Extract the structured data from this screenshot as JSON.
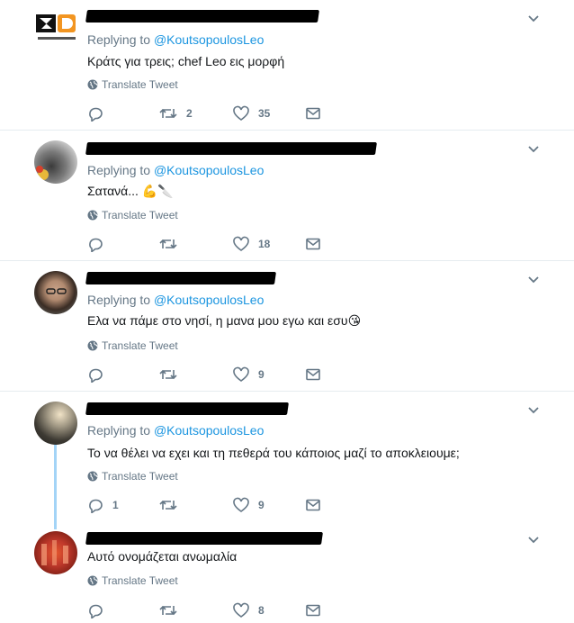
{
  "icons": {
    "reply": "reply-icon",
    "retweet": "retweet-icon",
    "like": "heart-icon",
    "dm": "envelope-icon",
    "translate": "globe-icon",
    "more": "chevron-down-icon"
  },
  "colors": {
    "accent": "#1b95e0",
    "muted": "#657786",
    "divider": "#e6ecf0",
    "thread": "#a3d4f7"
  },
  "tweets": [
    {
      "replying_label": "Replying to",
      "replying_handle": "@KoutsopoulosLeo",
      "text": "Κράτς για τρεις; chef Leo εις μορφή",
      "translate": "Translate Tweet",
      "replies": "",
      "retweets": "2",
      "likes": "35"
    },
    {
      "replying_label": "Replying to",
      "replying_handle": "@KoutsopoulosLeo",
      "text": "Σατανά...",
      "emoji": "💪🔪",
      "translate": "Translate Tweet",
      "replies": "",
      "retweets": "",
      "likes": "18"
    },
    {
      "replying_label": "Replying to",
      "replying_handle": "@KoutsopoulosLeo",
      "text": "Ελα να πάμε στο νησί, η μανα μου εγω και εσυ",
      "emoji": "😘",
      "translate": "Translate Tweet",
      "replies": "",
      "retweets": "",
      "likes": "9"
    },
    {
      "replying_label": "Replying to",
      "replying_handle": "@KoutsopoulosLeo",
      "text": "Το να θέλει να εχει και τη πεθερά του κάποιος μαζί το αποκλειουμε;",
      "translate": "Translate Tweet",
      "replies": "1",
      "retweets": "",
      "likes": "9"
    },
    {
      "text": "Αυτό ονομάζεται ανωμαλία",
      "translate": "Translate Tweet",
      "replies": "",
      "retweets": "",
      "likes": "8"
    }
  ]
}
